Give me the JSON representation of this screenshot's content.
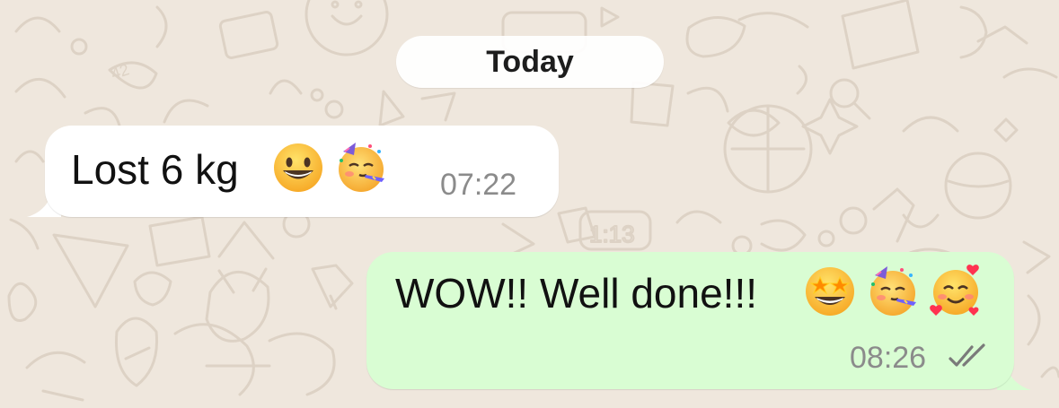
{
  "date_separator": {
    "label": "Today"
  },
  "messages": [
    {
      "direction": "incoming",
      "text": "Lost 6 kg",
      "emojis": [
        "grinning-face-emoji",
        "partying-face-emoji"
      ],
      "time": "07:22"
    },
    {
      "direction": "outgoing",
      "text": "WOW!! Well done!!!",
      "emojis": [
        "star-struck-emoji",
        "partying-face-emoji",
        "smiling-face-with-hearts-emoji"
      ],
      "time": "08:26",
      "status_icon": "double-check-icon"
    }
  ],
  "colors": {
    "chat_background": "#efe7dd",
    "incoming_bubble": "#ffffff",
    "outgoing_bubble": "#d9fdd3",
    "timestamp": "#8b8b8b"
  }
}
